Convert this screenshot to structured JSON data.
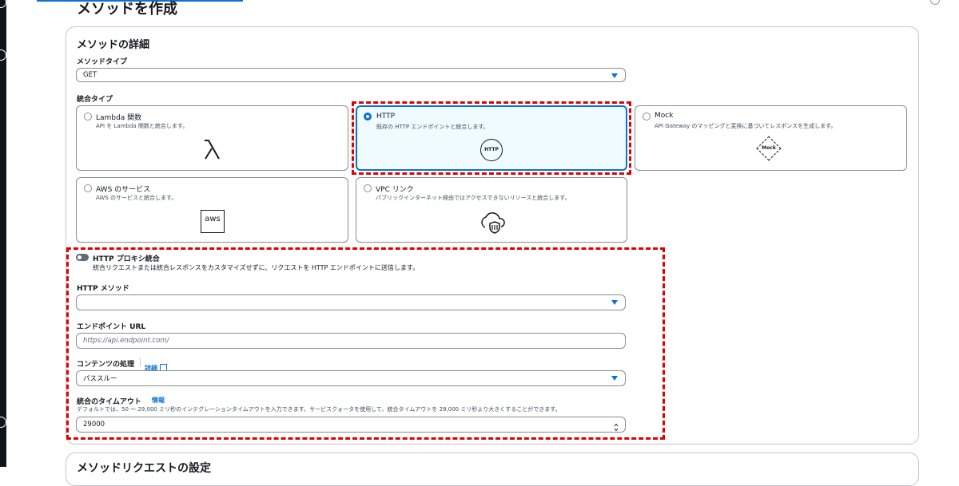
{
  "page": {
    "title": "メソッドを作成",
    "next_section_title": "メソッドリクエストの設定"
  },
  "details": {
    "heading": "メソッドの詳細",
    "method_type_label": "メソッドタイプ",
    "method_type_value": "GET",
    "integration_type_label": "統合タイプ"
  },
  "integration_types": [
    {
      "title": "Lambda 関数",
      "desc": "API を Lambda 関数と統合します。",
      "icon": "lambda-icon",
      "selected": false
    },
    {
      "title": "HTTP",
      "desc": "既存の HTTP エンドポイントと統合します。",
      "icon": "http-icon",
      "icon_text": "HTTP",
      "selected": true
    },
    {
      "title": "Mock",
      "desc": "API Gateway のマッピングと変換に基づいてレスポンスを生成します。",
      "icon": "mock-icon",
      "icon_text": "Mock",
      "selected": false
    },
    {
      "title": "AWS のサービス",
      "desc": "AWS のサービスと統合します。",
      "icon": "aws-icon",
      "icon_text": "aws",
      "selected": false
    },
    {
      "title": "VPC リンク",
      "desc": "パブリックインターネット経由ではアクセスできないリソースと統合します。",
      "icon": "vpc-link-icon",
      "selected": false
    }
  ],
  "http_settings": {
    "proxy_label": "HTTP プロキシ統合",
    "proxy_desc": "統合リクエストまたは統合レスポンスをカスタマイズせずに、リクエストを HTTP エンドポイントに送信します。",
    "proxy_enabled": false,
    "http_method_label": "HTTP メソッド",
    "http_method_value": "",
    "endpoint_label": "エンドポイント URL",
    "endpoint_placeholder": "https://api.endpoint.com/",
    "content_handling_label": "コンテンツの処理",
    "content_handling_link": "詳細",
    "content_handling_value": "パススルー",
    "timeout_label": "統合のタイムアウト",
    "timeout_link": "情報",
    "timeout_hint": "デフォルトでは、50 ～ 29,000 ミリ秒のインテグレーションタイムアウトを入力できます。サービスクォータを使用して、統合タイムアウトを 29,000 ミリ秒より大きくすることができます。",
    "timeout_value": "29000"
  },
  "colors": {
    "accent": "#0972d3",
    "highlight_dash": "#e00000",
    "selected_bg": "#f0fbff",
    "border": "#8c8c94"
  }
}
